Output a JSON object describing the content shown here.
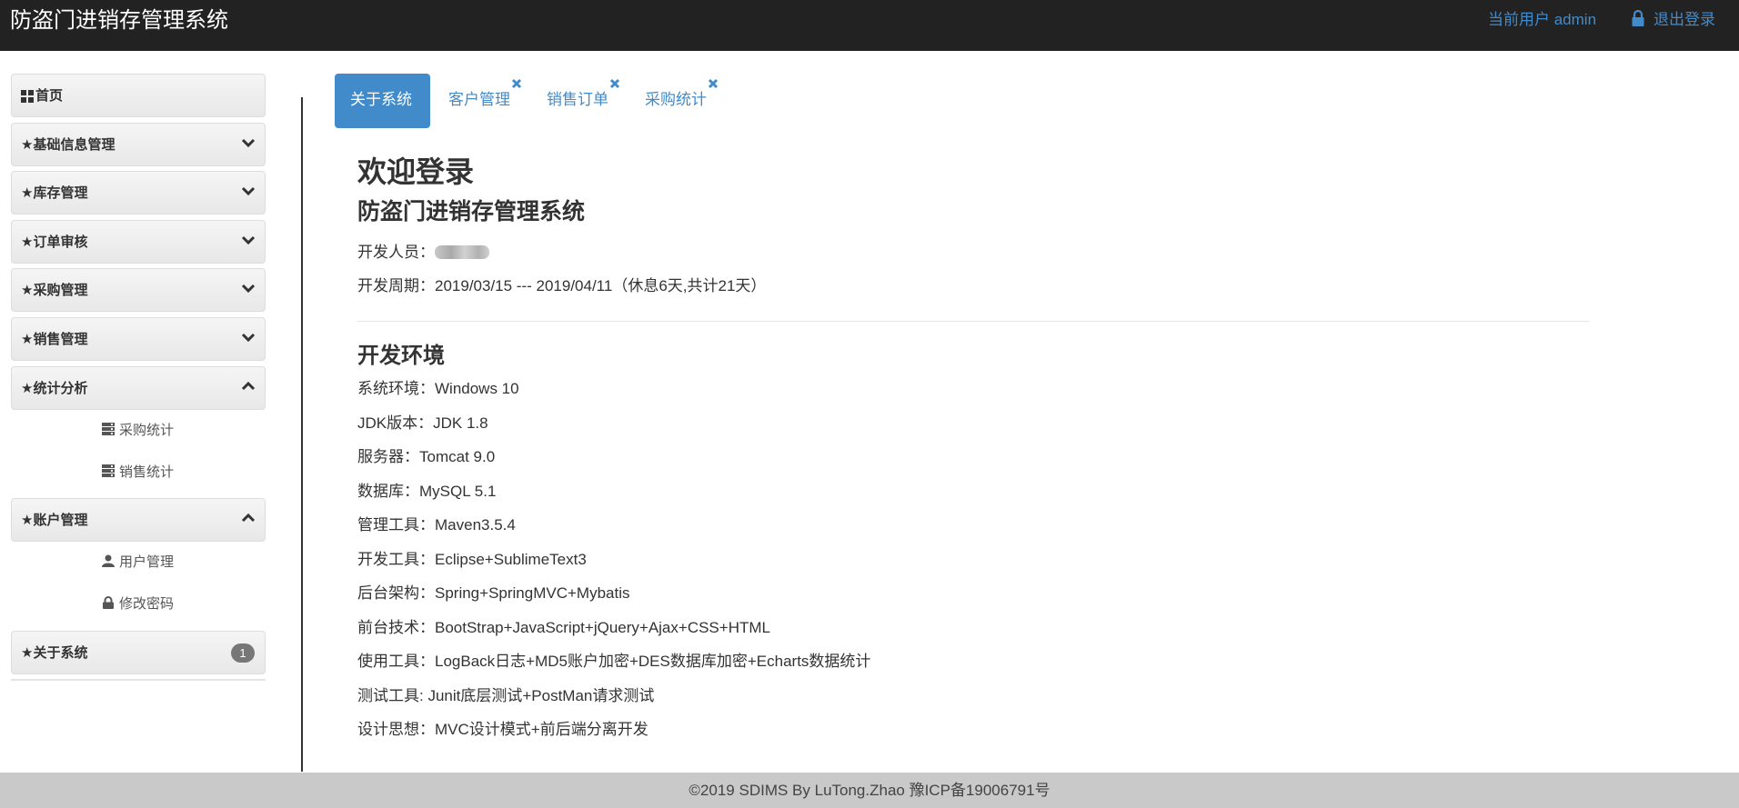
{
  "navbar": {
    "brand": "防盗门进销存管理系统",
    "current_user": "当前用户 admin",
    "logout": "退出登录"
  },
  "sidebar": {
    "home": "首页",
    "panels": [
      {
        "label": "★基础信息管理"
      },
      {
        "label": "★库存管理"
      },
      {
        "label": "★订单审核"
      },
      {
        "label": "★采购管理"
      },
      {
        "label": "★销售管理"
      },
      {
        "label": "★统计分析"
      },
      {
        "label": "★账户管理"
      },
      {
        "label": "★关于系统",
        "badge": "1"
      }
    ],
    "stats_items": [
      "采购统计",
      "销售统计"
    ],
    "account_items": [
      "用户管理",
      "修改密码"
    ]
  },
  "tabs": [
    "关于系统",
    "客户管理",
    "销售订单",
    "采购统计"
  ],
  "about": {
    "welcome": "欢迎登录",
    "system_name": "防盗门进销存管理系统",
    "developer_label": "开发人员：",
    "period": "开发周期：2019/03/15 --- 2019/04/11（休息6天,共计21天）",
    "env_title": "开发环境",
    "env_lines": [
      "系统环境：Windows 10",
      "JDK版本：JDK 1.8",
      "服务器：Tomcat 9.0",
      "数据库：MySQL 5.1",
      "管理工具：Maven3.5.4",
      "开发工具：Eclipse+SublimeText3",
      "后台架构：Spring+SpringMVC+Mybatis",
      "前台技术：BootStrap+JavaScript+jQuery+Ajax+CSS+HTML",
      "使用工具：LogBack日志+MD5账户加密+DES数据库加密+Echarts数据统计",
      "测试工具: Junit底层测试+PostMan请求测试",
      "设计思想：MVC设计模式+前后端分离开发"
    ]
  },
  "footer": "©2019 SDIMS By LuTong.Zhao 豫ICP备19006791号"
}
